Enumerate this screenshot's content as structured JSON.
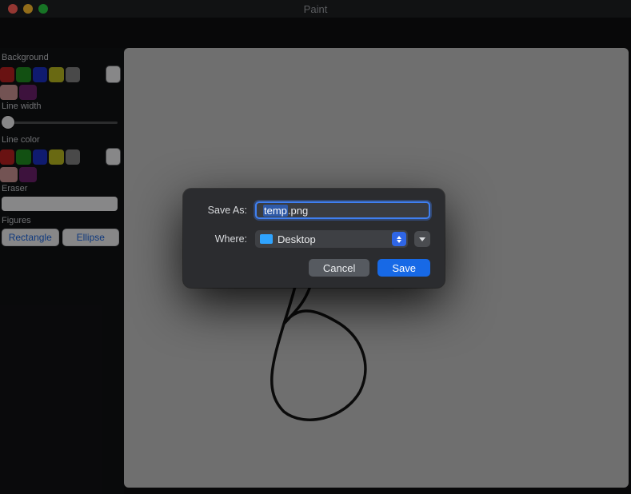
{
  "window": {
    "title": "Paint"
  },
  "sidebar": {
    "background_label": "Background",
    "line_width_label": "Line width",
    "line_color_label": "Line color",
    "eraser_label": "Eraser",
    "figures_label": "Figures",
    "rectangle_label": "Rectangle",
    "ellipse_label": "Ellipse",
    "bg_colors_row1": [
      "#b51f1f",
      "#1f8a1f",
      "#1a2fbf",
      "#b5b51f",
      "#7f7f7f"
    ],
    "bg_colors_row2": [
      "#c78f8f",
      "#6a1f6a"
    ],
    "line_colors_row1": [
      "#b51f1f",
      "#1f8a1f",
      "#1a2fbf",
      "#b5b51f",
      "#7f7f7f"
    ],
    "line_colors_row2": [
      "#c78f8f",
      "#6a1f6a"
    ],
    "selected_bg": "#e9e9eb",
    "selected_line": "#e9e9eb"
  },
  "dialog": {
    "save_as_label": "Save As:",
    "where_label": "Where:",
    "filename_selected": "temp",
    "filename_rest": ".png",
    "where_value": "Desktop",
    "cancel_label": "Cancel",
    "save_label": "Save"
  },
  "traffic_lights": {
    "close": "close",
    "minimize": "minimize",
    "zoom": "zoom"
  }
}
